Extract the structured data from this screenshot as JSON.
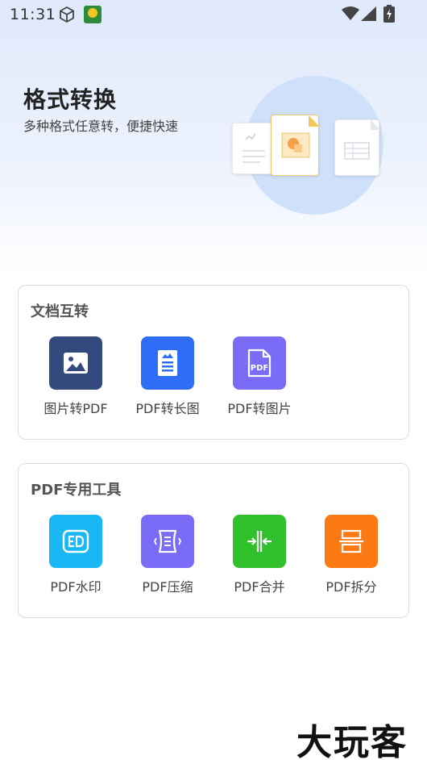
{
  "status_bar": {
    "time": "11:31"
  },
  "header": {
    "title": "格式转换",
    "subtitle": "多种格式任意转，便捷快速"
  },
  "sections": [
    {
      "title": "文档互转",
      "tools": [
        {
          "label": "图片转PDF",
          "icon": "image-icon",
          "color": "#34497e"
        },
        {
          "label": "PDF转长图",
          "icon": "long-image-icon",
          "color": "#2f6df6"
        },
        {
          "label": "PDF转图片",
          "icon": "pdf-file-icon",
          "color": "#7a6cf6"
        }
      ]
    },
    {
      "title": "PDF专用工具",
      "tools": [
        {
          "label": "PDF水印",
          "icon": "watermark-icon",
          "color": "#19b8f5"
        },
        {
          "label": "PDF压缩",
          "icon": "compress-icon",
          "color": "#7a6cf6"
        },
        {
          "label": "PDF合并",
          "icon": "merge-icon",
          "color": "#30c02b"
        },
        {
          "label": "PDF拆分",
          "icon": "split-icon",
          "color": "#fb7a14"
        }
      ]
    }
  ],
  "watermark": "大玩客"
}
